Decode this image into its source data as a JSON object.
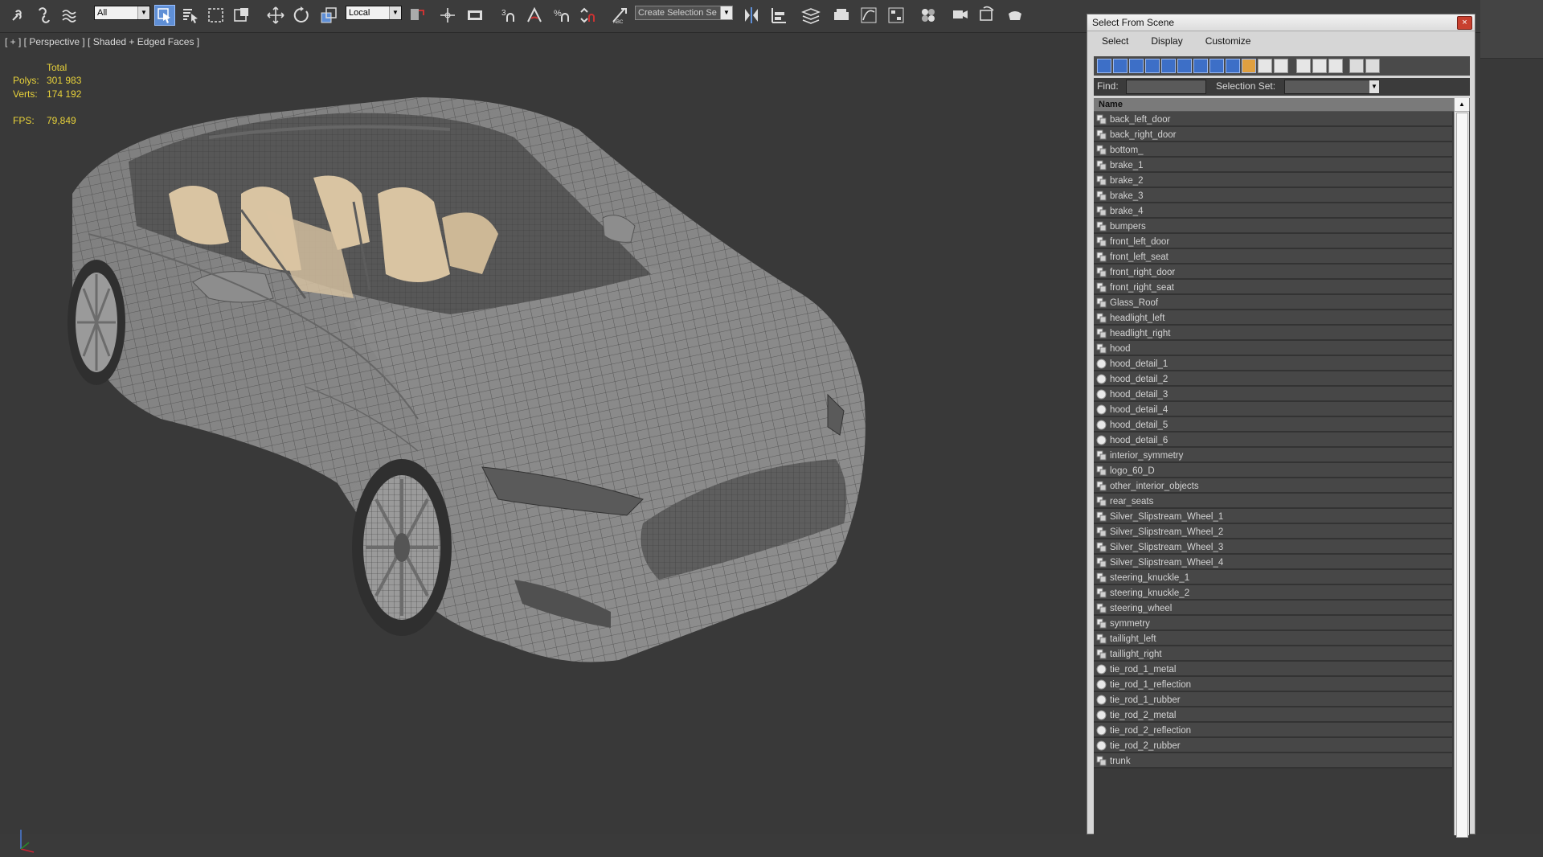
{
  "toolbar": {
    "filter_value": "All",
    "coord_system": "Local",
    "selection_set_placeholder": "Create Selection Se"
  },
  "viewport": {
    "label": "[ + ] [ Perspective ] [ Shaded + Edged Faces ]",
    "stats": {
      "header": "Total",
      "polys_label": "Polys:",
      "polys_value": "301 983",
      "verts_label": "Verts:",
      "verts_value": "174 192",
      "fps_label": "FPS:",
      "fps_value": "79,849"
    }
  },
  "dialog": {
    "title": "Select From Scene",
    "close_label": "×",
    "menu": [
      "Select",
      "Display",
      "Customize"
    ],
    "find_label": "Find:",
    "selection_set_label": "Selection Set:",
    "column_header": "Name",
    "items": [
      {
        "name": "back_left_door",
        "icon": "geometry-icon"
      },
      {
        "name": "back_right_door",
        "icon": "geometry-icon"
      },
      {
        "name": "bottom_",
        "icon": "geometry-icon"
      },
      {
        "name": "brake_1",
        "icon": "geometry-icon"
      },
      {
        "name": "brake_2",
        "icon": "geometry-icon"
      },
      {
        "name": "brake_3",
        "icon": "geometry-icon"
      },
      {
        "name": "brake_4",
        "icon": "geometry-icon"
      },
      {
        "name": "bumpers",
        "icon": "geometry-icon"
      },
      {
        "name": "front_left_door",
        "icon": "geometry-icon"
      },
      {
        "name": "front_left_seat",
        "icon": "geometry-icon"
      },
      {
        "name": "front_right_door",
        "icon": "geometry-icon"
      },
      {
        "name": "front_right_seat",
        "icon": "geometry-icon"
      },
      {
        "name": "Glass_Roof",
        "icon": "geometry-icon"
      },
      {
        "name": "headlight_left",
        "icon": "geometry-icon"
      },
      {
        "name": "headlight_right",
        "icon": "geometry-icon"
      },
      {
        "name": "hood",
        "icon": "geometry-icon"
      },
      {
        "name": "hood_detail_1",
        "icon": "sphere-icon"
      },
      {
        "name": "hood_detail_2",
        "icon": "sphere-icon"
      },
      {
        "name": "hood_detail_3",
        "icon": "sphere-icon"
      },
      {
        "name": "hood_detail_4",
        "icon": "sphere-icon"
      },
      {
        "name": "hood_detail_5",
        "icon": "sphere-icon"
      },
      {
        "name": "hood_detail_6",
        "icon": "sphere-icon"
      },
      {
        "name": "interior_symmetry",
        "icon": "geometry-icon"
      },
      {
        "name": "logo_60_D",
        "icon": "geometry-icon"
      },
      {
        "name": "other_interior_objects",
        "icon": "geometry-icon"
      },
      {
        "name": "rear_seats",
        "icon": "geometry-icon"
      },
      {
        "name": "Silver_Slipstream_Wheel_1",
        "icon": "geometry-icon"
      },
      {
        "name": "Silver_Slipstream_Wheel_2",
        "icon": "geometry-icon"
      },
      {
        "name": "Silver_Slipstream_Wheel_3",
        "icon": "geometry-icon"
      },
      {
        "name": "Silver_Slipstream_Wheel_4",
        "icon": "geometry-icon"
      },
      {
        "name": "steering_knuckle_1",
        "icon": "geometry-icon"
      },
      {
        "name": "steering_knuckle_2",
        "icon": "geometry-icon"
      },
      {
        "name": "steering_wheel",
        "icon": "geometry-icon"
      },
      {
        "name": "symmetry",
        "icon": "geometry-icon"
      },
      {
        "name": "taillight_left",
        "icon": "geometry-icon"
      },
      {
        "name": "taillight_right",
        "icon": "geometry-icon"
      },
      {
        "name": "tie_rod_1_metal",
        "icon": "sphere-icon"
      },
      {
        "name": "tie_rod_1_reflection",
        "icon": "sphere-icon"
      },
      {
        "name": "tie_rod_1_rubber",
        "icon": "sphere-icon"
      },
      {
        "name": "tie_rod_2_metal",
        "icon": "sphere-icon"
      },
      {
        "name": "tie_rod_2_reflection",
        "icon": "sphere-icon"
      },
      {
        "name": "tie_rod_2_rubber",
        "icon": "sphere-icon"
      },
      {
        "name": "trunk",
        "icon": "geometry-icon"
      }
    ]
  },
  "colors": {
    "viewport_bg": "#393939",
    "stats_yellow": "#e8d23a",
    "toolbar_active": "#5f8fd6",
    "list_row": "#474747"
  }
}
